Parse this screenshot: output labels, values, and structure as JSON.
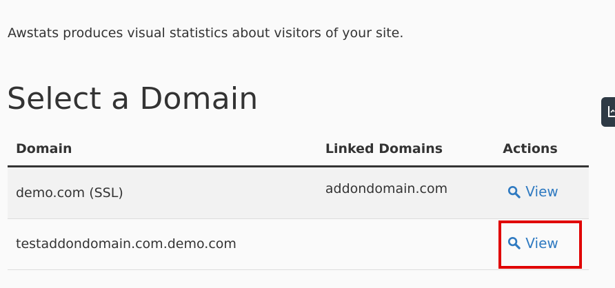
{
  "intro_text": "Awstats produces visual statistics about visitors of your site.",
  "page_title": "Select a Domain",
  "table": {
    "headers": {
      "domain": "Domain",
      "linked_domains": "Linked Domains",
      "actions": "Actions"
    },
    "rows": [
      {
        "domain": "demo.com (SSL)",
        "linked_domains": "addondomain.com",
        "action_label": "View"
      },
      {
        "domain": "testaddondomain.com.demo.com",
        "linked_domains": "",
        "action_label": "View"
      }
    ]
  },
  "icons": {
    "view_icon": "search-icon",
    "side_tab_icon": "document-icon"
  },
  "colors": {
    "link": "#2f7ac1",
    "highlight_box": "#e00000",
    "side_tab": "#2e3a45",
    "text": "#333333"
  }
}
